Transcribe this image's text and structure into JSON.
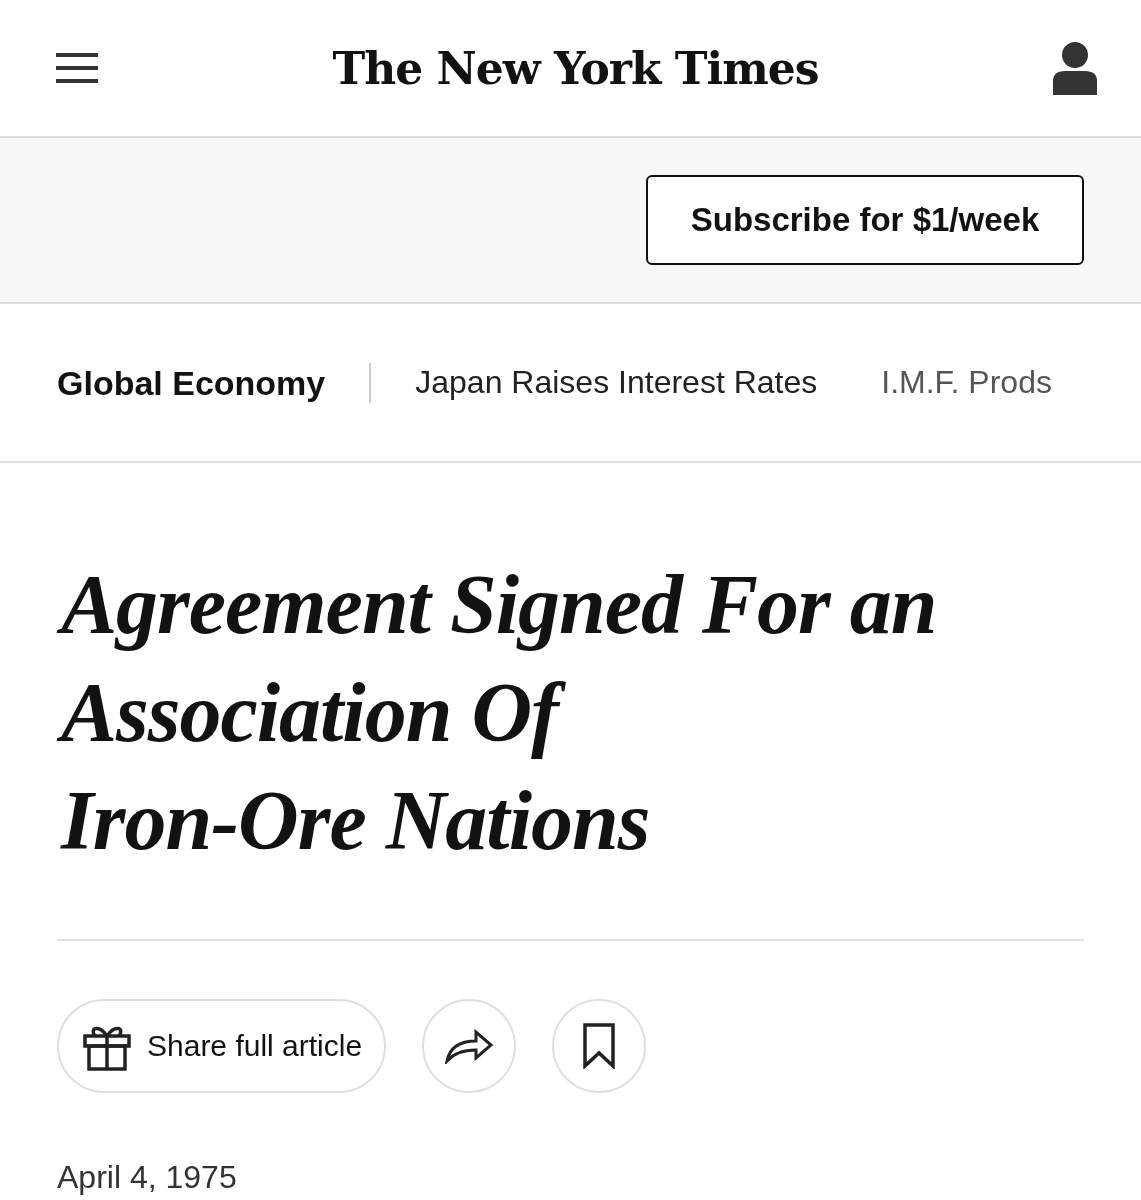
{
  "header": {
    "logo": "The New York Times"
  },
  "subscribe": {
    "label": "Subscribe for $1/week"
  },
  "nav": {
    "section": "Global Economy",
    "links": [
      "Japan Raises Interest Rates",
      "I.M.F. Prods"
    ]
  },
  "headline": [
    "Agreement Signed For an",
    "Association Of",
    "Iron-Ore Nations"
  ],
  "actions": {
    "share_label": "Share full article"
  },
  "date": "April 4, 1975"
}
